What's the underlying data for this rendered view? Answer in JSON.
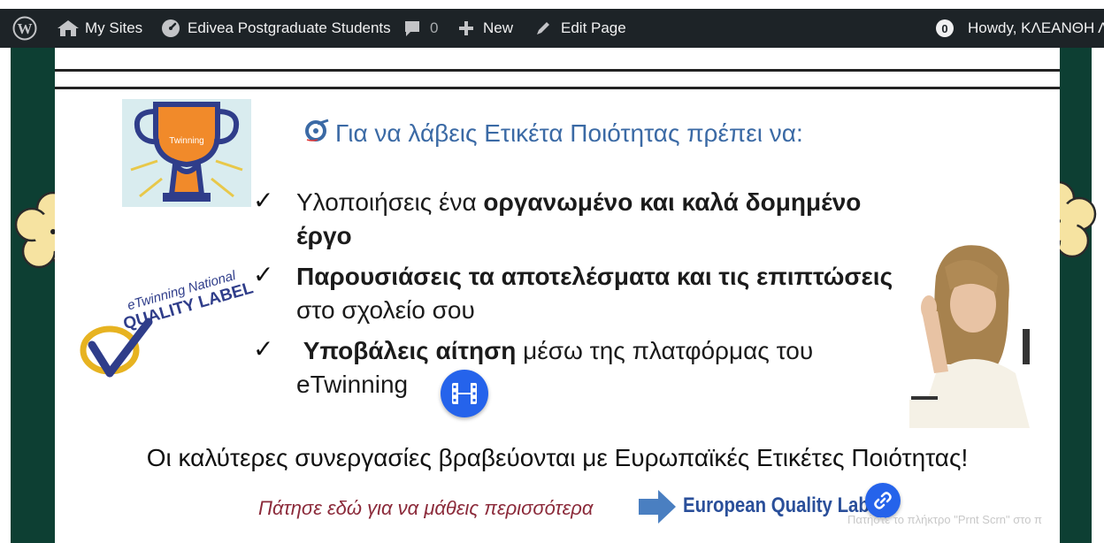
{
  "admin_bar": {
    "my_sites": "My Sites",
    "site_name": "Edivea Postgraduate Students",
    "comments_count": "0",
    "new_label": "New",
    "edit_page_label": "Edit Page",
    "notification_count": "0",
    "howdy": "Howdy, ΚΛΕΑΝΘΗ Λ"
  },
  "slide": {
    "title": "Για να λάβεις Ετικέτα Ποιότητας πρέπει να:",
    "trophy_text": "Twinning",
    "quality_label_line1": "eTwinning National",
    "quality_label_line2": "QUALITY LABEL",
    "check_mark": "✓",
    "bullets": [
      {
        "plain_before": "Υλοποιήσεις ένα ",
        "bold": "οργανωμένο και καλά δομημένο",
        "line2_bold": "έργο",
        "line2_plain": ""
      },
      {
        "plain_before": "",
        "bold": "Παρουσιάσεις τα αποτελέσματα και τις επιπτώσεις",
        "line2_bold": "",
        "line2_plain": "στο σχολείο σου"
      },
      {
        "plain_before": "",
        "bold": "Υποβάλεις αίτηση",
        "plain_after": " μέσω της πλατφόρμας του",
        "line2_bold": "",
        "line2_plain": "eTwinning"
      }
    ],
    "bottom_text": "Οι καλύτερες συνεργασίες βραβεύονται με Ευρωπαϊκές Ετικέτες Ποιότητας!",
    "learn_more": "Πάτησε εδώ για να μάθεις περισσότερα",
    "eql_link": "European Quality Label"
  },
  "watermark": "Πατήστε το πλήκτρο \"Prnt Scrn\" στο π",
  "colors": {
    "admin_bg": "#1d2327",
    "frame_green": "#0d3f33",
    "title_blue": "#3b6aa5",
    "button_blue": "#2563eb",
    "flower_yellow": "#f6e3a1",
    "learn_red": "#8b2a3a"
  }
}
